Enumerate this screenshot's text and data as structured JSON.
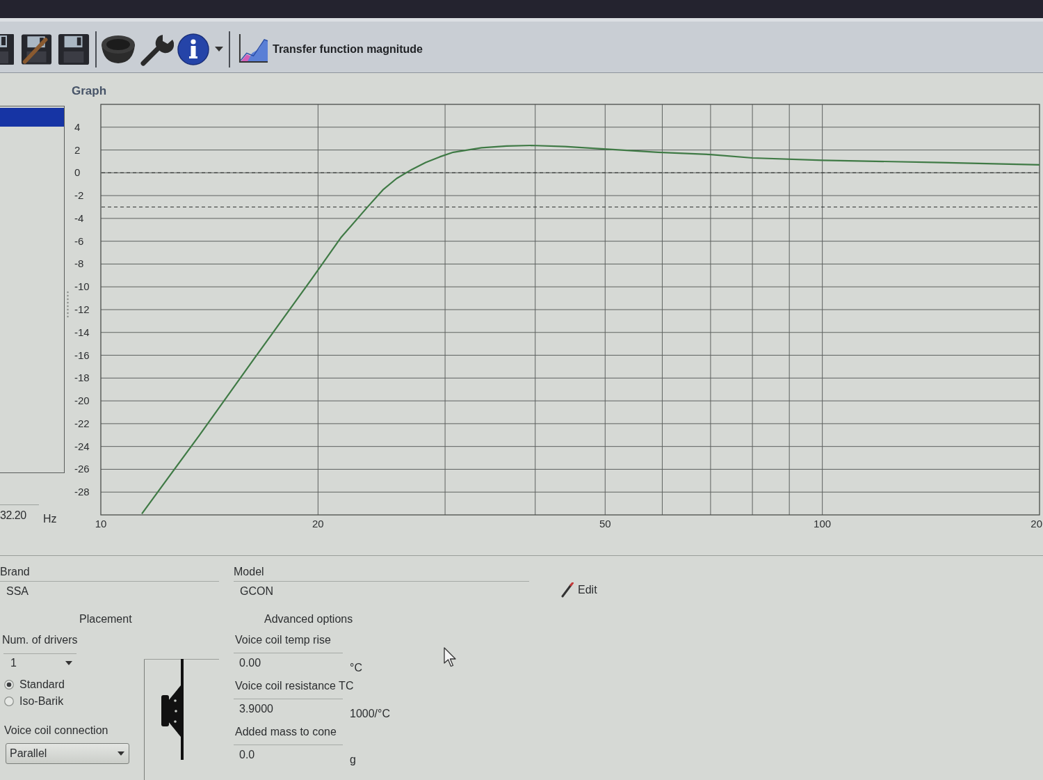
{
  "toolbar": {
    "chart_selector": {
      "label": "Transfer function magnitude"
    }
  },
  "graph": {
    "title": "Graph",
    "project_list": {
      "items": [
        {
          "selected": true
        }
      ]
    },
    "frequency": {
      "value": "32.20",
      "unit": "Hz"
    },
    "chart_data": {
      "type": "line",
      "log": "x",
      "grid": true,
      "x": [
        11.4,
        13.7,
        16.4,
        19.6,
        21.5,
        23.5,
        24.6,
        25.7,
        27,
        28.2,
        29.5,
        30.8,
        33.7,
        36.5,
        39.5,
        44,
        49.4,
        59.2,
        70,
        80,
        100,
        146,
        200
      ],
      "series": [
        {
          "color": "#3f7a45",
          "values": [
            -29.9,
            -23.0,
            -16.1,
            -9.3,
            -5.7,
            -2.9,
            -1.5,
            -0.5,
            0.3,
            0.9,
            1.4,
            1.8,
            2.2,
            2.35,
            2.4,
            2.3,
            2.1,
            1.8,
            1.6,
            1.3,
            1.1,
            0.9,
            0.7
          ]
        }
      ],
      "xlim": [
        10,
        200
      ],
      "ylim": [
        -30,
        6
      ],
      "xticks": [
        10,
        20,
        50,
        100
      ],
      "yticks": [
        4,
        2,
        0,
        -2,
        -4,
        -6,
        -8,
        -10,
        -12,
        -14,
        -16,
        -18,
        -20,
        -22,
        -24,
        -26,
        -28
      ],
      "ref_lines": [
        {
          "axis": "y",
          "value": 0
        },
        {
          "axis": "y",
          "value": -3
        }
      ]
    },
    "cut_axis_label": "20"
  },
  "driver": {
    "brand": {
      "label": "Brand",
      "value": "SSA"
    },
    "model": {
      "label": "Model",
      "value": "GCON"
    },
    "edit_button": {
      "label": "Edit"
    }
  },
  "placement": {
    "title": "Placement",
    "num_drivers": {
      "label": "Num. of drivers",
      "value": "1"
    },
    "modes": [
      {
        "label": "Standard",
        "selected": true
      },
      {
        "label": "Iso-Barik",
        "selected": false
      }
    ],
    "voice_coil_connection": {
      "label": "Voice coil connection",
      "value": "Parallel"
    }
  },
  "advanced_options": {
    "title": "Advanced options",
    "fields": [
      {
        "label": "Voice coil temp rise",
        "value": "0.00",
        "unit": "°C"
      },
      {
        "label": "Voice coil resistance TC",
        "value": "3.9000",
        "unit": "1000/°C"
      },
      {
        "label": "Added mass to cone",
        "value": "0.0",
        "unit": "g"
      }
    ]
  }
}
